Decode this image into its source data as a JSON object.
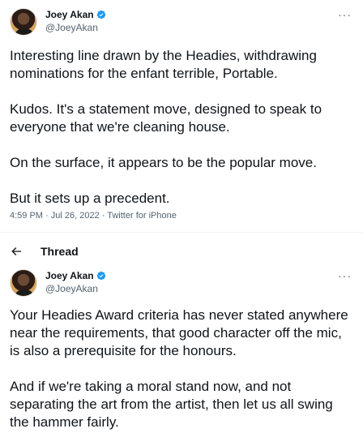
{
  "tweet_main": {
    "display_name": "Joey Akan",
    "handle": "@JoeyAkan",
    "paragraphs": [
      "Interesting line drawn by the Headies, withdrawing nominations for the enfant terrible, Portable.",
      "Kudos. It's a statement move, designed to speak to everyone that we're cleaning house.",
      "On the surface, it appears to be the popular move.",
      "But it sets up a precedent."
    ],
    "meta": "4:59 PM · Jul 26, 2022 · Twitter for iPhone"
  },
  "thread": {
    "title": "Thread"
  },
  "tweet_reply": {
    "display_name": "Joey Akan",
    "handle": "@JoeyAkan",
    "paragraphs": [
      "Your Headies Award criteria has never stated anywhere near the requirements, that good character off the mic, is also a prerequisite for the honours.",
      "And if we're taking a moral stand now, and not separating the art from the artist, then let us all swing the hammer fairly."
    ]
  },
  "more_glyph": "···",
  "colors": {
    "verified": "#1d9bf0",
    "text": "#0f1419",
    "secondary": "#536471",
    "divider": "#eff3f4"
  },
  "icons": {
    "verified": "verified-badge-icon",
    "more": "more-icon",
    "back": "back-arrow-icon"
  }
}
